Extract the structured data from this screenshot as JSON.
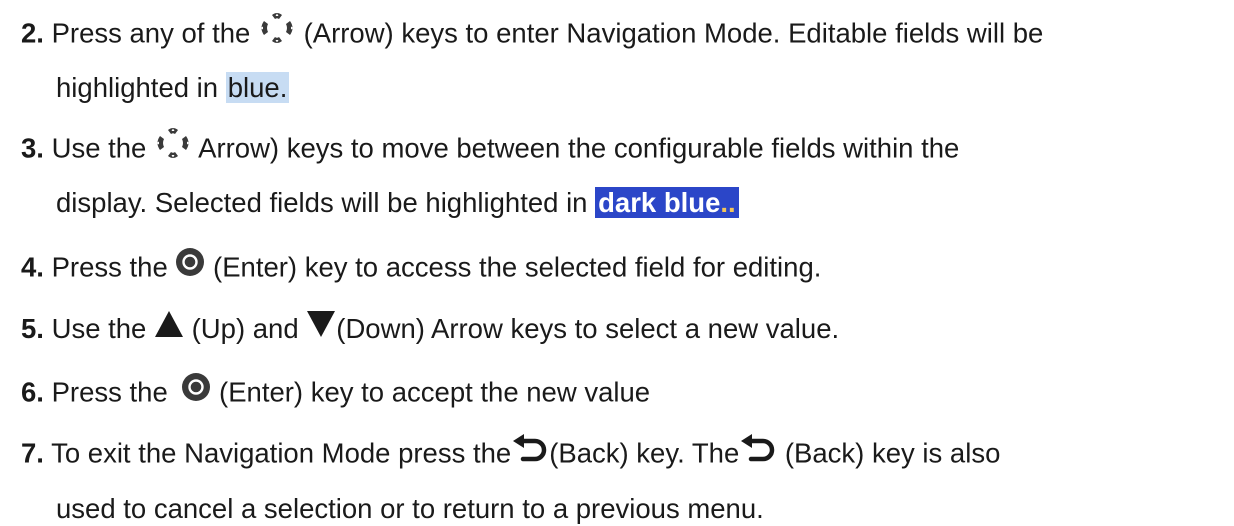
{
  "steps": [
    {
      "number": "2.",
      "icon": "arrow-keys-icon",
      "before": "Press any of the",
      "after": "(Arrow) keys to enter Navigation Mode. Editable fields will be",
      "line2_before": "highlighted in",
      "highlight": "blue",
      "line2_after": "."
    },
    {
      "number": "3.",
      "icon": "arrow-keys-icon",
      "before": "Use the",
      "after": "Arrow) keys to move between the configurable fields within the",
      "line2_before": "display. Selected fields will be highlighted in",
      "highlight": "dark blue",
      "highlight_tail": ".."
    },
    {
      "number": "4.",
      "icon": "enter-key-icon",
      "before": "Press the",
      "after": "(Enter) key to access the selected field for editing."
    },
    {
      "number": "5.",
      "icon_up": "up-arrow-icon",
      "icon_down": "down-arrow-icon",
      "before": "Use the",
      "middle": "(Up) and",
      "after": "(Down) Arrow keys to select a new value."
    },
    {
      "number": "6.",
      "icon": "enter-key-icon",
      "before": "Press the",
      "after": "(Enter) key to accept the new value"
    },
    {
      "number": "7.",
      "icon": "back-key-icon",
      "before": "To exit the Navigation Mode press the",
      "middle": "(Back) key. The",
      "after": "(Back) key is also",
      "line2": "used to cancel a selection or to return to a previous menu."
    }
  ],
  "colors": {
    "highlight_light": "#c7dcf3",
    "highlight_dark": "#2b46c8",
    "icon_dark": "#3a3a3a"
  }
}
